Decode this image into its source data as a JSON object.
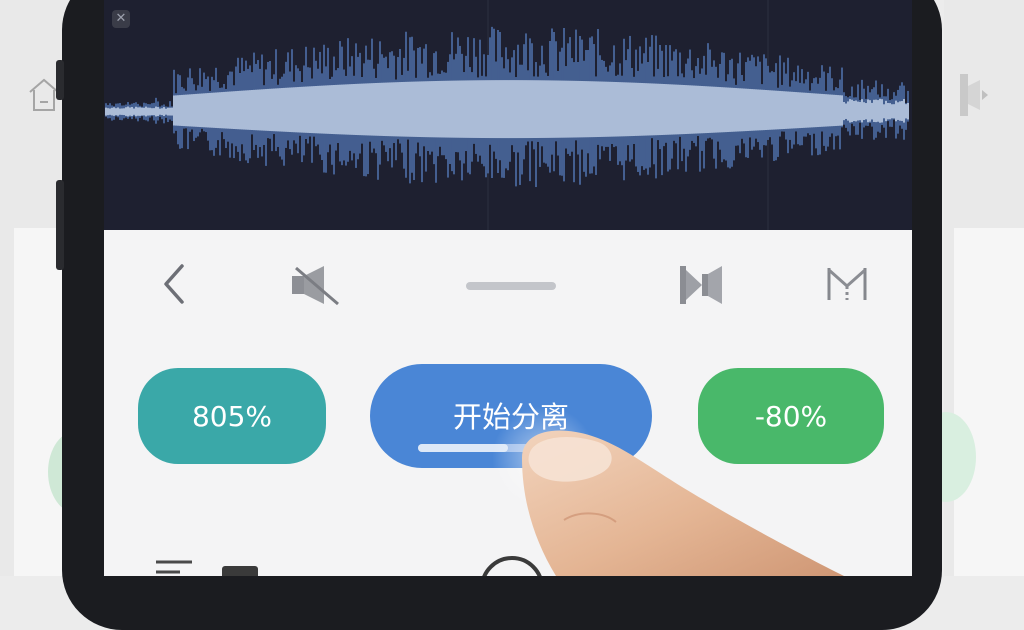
{
  "toolbar": {
    "icons": [
      "back-chevron-icon",
      "mute-speaker-icon",
      "drag-handle",
      "play-split-icon",
      "split-marker-icon"
    ]
  },
  "buttons": {
    "left_value": "805%",
    "main_label": "开始分离",
    "right_value": "-80%"
  },
  "progress": {
    "fraction": 0.6
  },
  "colors": {
    "waveform_bg": "#1e2030",
    "wave_light": "#b8c8e2",
    "wave_dark": "#4d6fa8",
    "teal_button": "#3aa8a8",
    "blue_button": "#4a86d6",
    "green_button": "#49b86a"
  }
}
